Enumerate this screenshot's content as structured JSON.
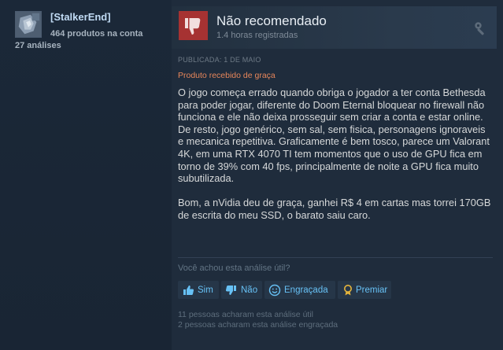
{
  "author": {
    "name": "[StalkerEnd]",
    "products_owned": "464 produtos na conta",
    "review_count": "27 análises"
  },
  "review": {
    "verdict": "Não recomendado",
    "hours": "1.4 horas registradas",
    "posted": "PUBLICADA: 1 DE MAIO",
    "free_product": "Produto recebido de graça",
    "paragraphs": [
      "O jogo começa errado quando obriga o jogador a ter conta Bethesda para poder jogar, diferente do Doom Eternal bloquear no firewall não funciona e ele não deixa prosseguir sem criar a conta e estar online.",
      "De resto, jogo genérico, sem sal, sem fisica, personagens ignoraveis e mecanica repetitiva. Graficamente é bem tosco, parece um Valorant 4K, em uma RTX 4070 TI tem momentos que o uso de GPU fica em torno de 39% com 40 fps, principalmente de noite a GPU fica muito subutilizada.",
      "",
      "Bom, a nVidia deu de graça, ganhei R$ 4 em cartas mas torrei 170GB de escrita do meu SSD, o barato saiu caro."
    ]
  },
  "feedback": {
    "question": "Você achou esta análise útil?",
    "yes_label": "Sim",
    "no_label": "Não",
    "funny_label": "Engraçada",
    "award_label": "Premiar",
    "helpful_stat": "11 pessoas acharam esta análise útil",
    "funny_stat": "2 pessoas acharam esta análise engraçada"
  },
  "colors": {
    "accent_link": "#67c1f5",
    "not_recommended": "#a32f2f",
    "free_product": "#e7865a"
  },
  "icons": {
    "avatar": "avatar-image",
    "verdict": "thumbs-down-icon",
    "settings": "wrench-icon",
    "yes": "thumbs-up-icon",
    "no": "thumbs-down-icon",
    "funny": "smiley-icon",
    "award": "award-icon"
  }
}
